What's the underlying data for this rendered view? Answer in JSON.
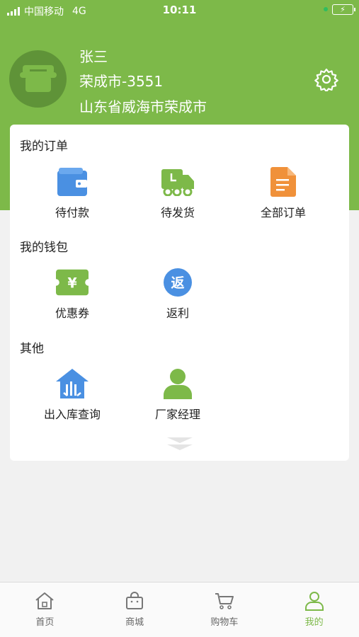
{
  "status_bar": {
    "carrier": "中国移动",
    "network": "4G",
    "time": "10:11"
  },
  "profile": {
    "name": "张三",
    "code": "荣成市-3551",
    "address": "山东省威海市荣成市"
  },
  "orders": {
    "title": "我的订单",
    "items": [
      {
        "label": "待付款",
        "icon": "wallet-icon",
        "color": "#4a90e2"
      },
      {
        "label": "待发货",
        "icon": "truck-icon",
        "color": "#7db949"
      },
      {
        "label": "全部订单",
        "icon": "document-icon",
        "color": "#f0913a"
      }
    ]
  },
  "wallet": {
    "title": "我的钱包",
    "items": [
      {
        "label": "优惠券",
        "icon": "coupon-icon",
        "color": "#7db949",
        "glyph": "¥"
      },
      {
        "label": "返利",
        "icon": "rebate-icon",
        "color": "#4a90e2",
        "glyph": "返"
      }
    ]
  },
  "other": {
    "title": "其他",
    "items": [
      {
        "label": "出入库查询",
        "icon": "warehouse-icon",
        "color": "#4a90e2"
      },
      {
        "label": "厂家经理",
        "icon": "manager-icon",
        "color": "#7db949"
      }
    ]
  },
  "tabbar": {
    "items": [
      {
        "label": "首页",
        "icon": "home-icon",
        "active": false
      },
      {
        "label": "商城",
        "icon": "shop-bag-icon",
        "active": false
      },
      {
        "label": "购物车",
        "icon": "cart-icon",
        "active": false
      },
      {
        "label": "我的",
        "icon": "profile-icon",
        "active": true
      }
    ]
  },
  "colors": {
    "brand": "#7db949",
    "background": "#f1f1f1",
    "card": "#ffffff",
    "active_tab": "#7db949"
  }
}
